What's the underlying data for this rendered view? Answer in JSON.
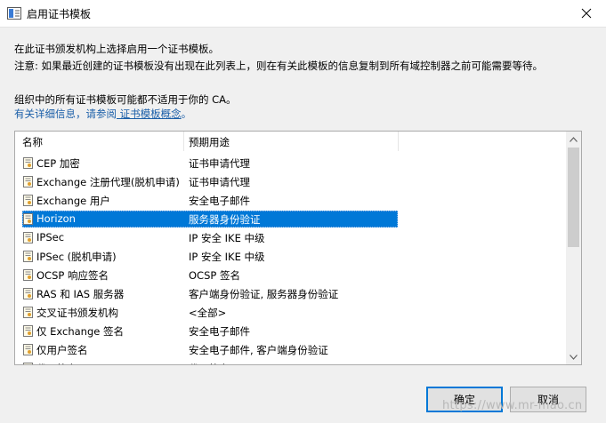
{
  "window": {
    "title": "启用证书模板",
    "close_label": "×"
  },
  "intro": {
    "line1": "在此证书颁发机构上选择启用一个证书模板。",
    "line2": "注意: 如果最近创建的证书模板没有出现在此列表上，则在有关此模板的信息复制到所有域控制器之前可能需要等待。",
    "line3": "组织中的所有证书模板可能都不适用于你的 CA。",
    "more_info_prefix": "有关详细信息，请参阅",
    "more_info_link": " 证书模板概念",
    "more_info_suffix": "。"
  },
  "list": {
    "columns": [
      "名称",
      "预期用途"
    ],
    "rows": [
      {
        "name": "CEP 加密",
        "purpose": "证书申请代理"
      },
      {
        "name": "Exchange 注册代理(脱机申请)",
        "purpose": "证书申请代理"
      },
      {
        "name": "Exchange 用户",
        "purpose": "安全电子邮件"
      },
      {
        "name": "Horizon",
        "purpose": "服务器身份验证"
      },
      {
        "name": "IPSec",
        "purpose": "IP 安全 IKE 中级"
      },
      {
        "name": "IPSec (脱机申请)",
        "purpose": "IP 安全 IKE 中级"
      },
      {
        "name": "OCSP 响应签名",
        "purpose": "OCSP 签名"
      },
      {
        "name": "RAS 和 IAS 服务器",
        "purpose": "客户端身份验证, 服务器身份验证"
      },
      {
        "name": "交叉证书颁发机构",
        "purpose": "<全部>"
      },
      {
        "name": "仅 Exchange 签名",
        "purpose": "安全电子邮件"
      },
      {
        "name": "仅用户签名",
        "purpose": "安全电子邮件, 客户端身份验证"
      },
      {
        "name": "代码签名",
        "purpose": "代码签名"
      }
    ],
    "selected": "Horizon"
  },
  "buttons": {
    "ok": "确定",
    "cancel": "取消"
  },
  "watermark": "https://www.mr-mao.cn",
  "colors": {
    "selection": "#0078d7",
    "link": "#1a5ea8"
  }
}
